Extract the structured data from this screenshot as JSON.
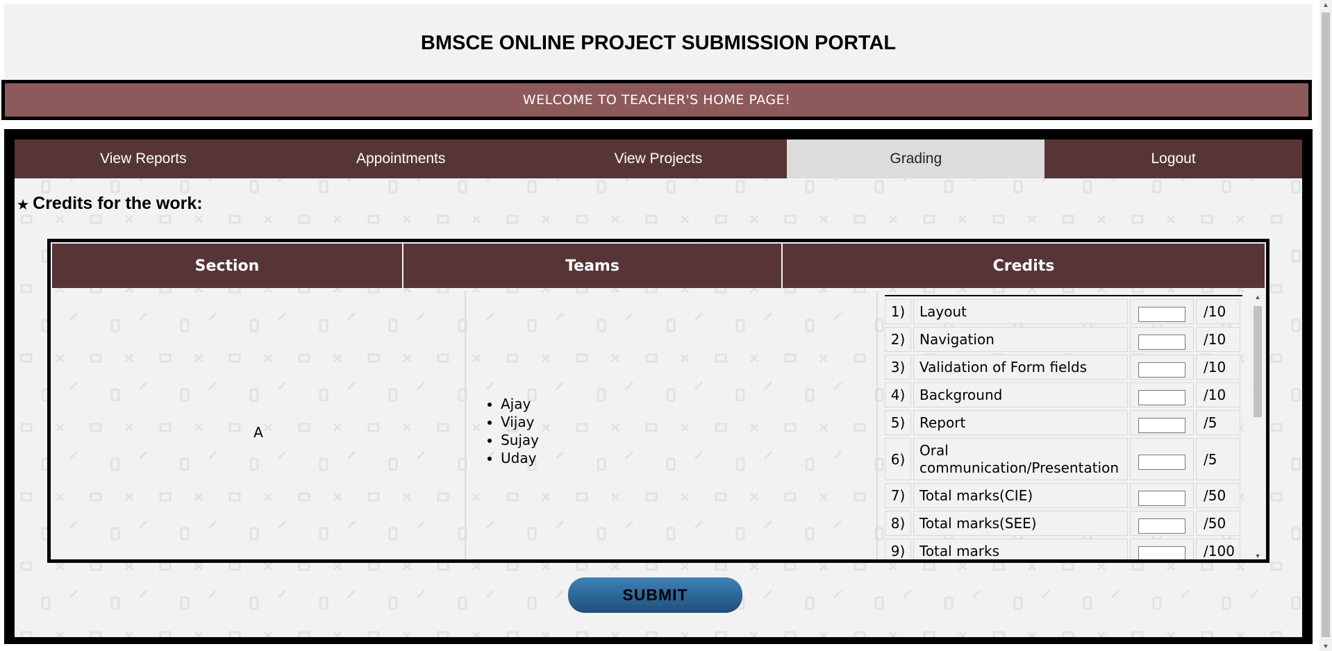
{
  "header": {
    "title": "BMSCE ONLINE PROJECT SUBMISSION PORTAL"
  },
  "welcome": {
    "text": "WELCOME TO TEACHER'S HOME PAGE!"
  },
  "nav": {
    "items": [
      {
        "label": "View Reports",
        "active": false
      },
      {
        "label": "Appointments",
        "active": false
      },
      {
        "label": "View Projects",
        "active": false
      },
      {
        "label": "Grading",
        "active": true
      },
      {
        "label": "Logout",
        "active": false
      }
    ]
  },
  "credits_title": "Credits for the work:",
  "table": {
    "headers": [
      "Section",
      "Teams",
      "Credits"
    ],
    "section": "A",
    "teams": [
      "Ajay",
      "Vijay",
      "Sujay",
      "Uday"
    ],
    "credits": [
      {
        "num": "1)",
        "label": "Layout",
        "max": "/10",
        "value": ""
      },
      {
        "num": "2)",
        "label": "Navigation",
        "max": "/10",
        "value": ""
      },
      {
        "num": "3)",
        "label": "Validation of Form fields",
        "max": "/10",
        "value": ""
      },
      {
        "num": "4)",
        "label": "Background",
        "max": "/10",
        "value": ""
      },
      {
        "num": "5)",
        "label": "Report",
        "max": "/5",
        "value": ""
      },
      {
        "num": "6)",
        "label": "Oral communication/Presentation",
        "max": "/5",
        "value": ""
      },
      {
        "num": "7)",
        "label": "Total marks(CIE)",
        "max": "/50",
        "value": ""
      },
      {
        "num": "8)",
        "label": "Total marks(SEE)",
        "max": "/50",
        "value": ""
      },
      {
        "num": "9)",
        "label": "Total marks",
        "max": "/100",
        "value": ""
      }
    ]
  },
  "submit": {
    "label": "SUBMIT"
  },
  "colors": {
    "nav_bg": "#573536",
    "welcome_bg": "#8d5a5b",
    "button": "#2b6496"
  }
}
